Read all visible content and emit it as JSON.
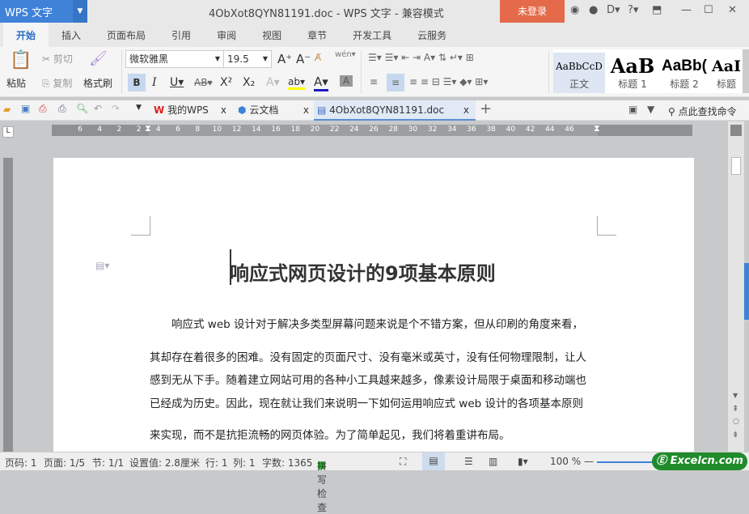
{
  "app": {
    "logo": "WPS 文字",
    "title": "4ObXot8QYN81191.doc - WPS 文字 - 兼容模式",
    "login": "未登录"
  },
  "menu_tabs": [
    "开始",
    "插入",
    "页面布局",
    "引用",
    "审阅",
    "视图",
    "章节",
    "开发工具",
    "云服务"
  ],
  "ribbon": {
    "paste": "粘贴",
    "cut": "剪切",
    "copy": "复制",
    "format_painter": "格式刷",
    "font": "微软雅黑",
    "size": "19.5",
    "styles": [
      {
        "preview": "AaBbCcD",
        "name": "正文"
      },
      {
        "preview": "AaB",
        "name": "标题 1"
      },
      {
        "preview": "AaBb(",
        "name": "标题 2"
      },
      {
        "preview": "AaI",
        "name": "标题"
      }
    ]
  },
  "doc_tabs": [
    "我的WPS",
    "云文档",
    "4ObXot8QYN81191.doc"
  ],
  "search_cmd": "点此查找命令",
  "ruler_ticks": [
    "6",
    "4",
    "2",
    "2",
    "4",
    "6",
    "8",
    "10",
    "12",
    "14",
    "16",
    "18",
    "20",
    "22",
    "24",
    "26",
    "28",
    "30",
    "32",
    "34",
    "36",
    "38",
    "40",
    "42",
    "44",
    "46"
  ],
  "document": {
    "title": "响应式网页设计的9项基本原则",
    "lines": [
      "响应式 web 设计对于解决多类型屏幕问题来说是个不错方案，但从印刷的角度来看，",
      "其却存在着很多的困难。没有固定的页面尺寸、没有毫米或英寸，没有任何物理限制，让人",
      "感到无从下手。随着建立网站可用的各种小工具越来越多，像素设计局限于桌面和移动端也",
      "已经成为历史。因此，现在就让我们来说明一下如何运用响应式 web 设计的各项基本原则",
      "来实现，而不是抗拒流畅的网页体验。为了简单起见，我们将着重讲布局。"
    ]
  },
  "status": {
    "page_no": "页码: 1",
    "pages": "页面: 1/5",
    "section": "节: 1/1",
    "setting": "设置值: 2.8厘米",
    "row": "行: 1",
    "col": "列: 1",
    "words": "字数: 1365",
    "spell": "拼写检查",
    "zoom": "100 %"
  },
  "watermark": "Excelcn.com"
}
